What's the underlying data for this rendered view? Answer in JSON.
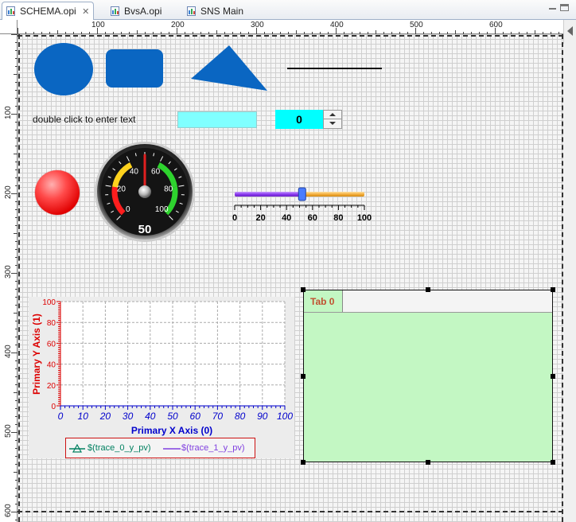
{
  "editor_tabs": [
    {
      "label": "SCHEMA.opi",
      "active": true,
      "closable": true
    },
    {
      "label": "BvsA.opi",
      "active": false,
      "closable": false
    },
    {
      "label": "SNS Main",
      "active": false,
      "closable": false
    }
  ],
  "ruler": {
    "horizontal_labels": [
      "100",
      "200",
      "300",
      "400",
      "500",
      "600"
    ],
    "vertical_labels": [
      "100",
      "200",
      "300",
      "400",
      "500",
      "600"
    ]
  },
  "widgets": {
    "label_text": "double click to enter text",
    "text_input_value": "",
    "spinner_value": "0",
    "gauge": {
      "value": 50,
      "min": 0,
      "max": 100,
      "ticks": [
        "0",
        "20",
        "40",
        "60",
        "80",
        "100"
      ],
      "readout": "50"
    },
    "slider": {
      "value": 52,
      "min": 0,
      "max": 100,
      "ticks": [
        "0",
        "20",
        "40",
        "60",
        "80",
        "100"
      ]
    },
    "tab_container": {
      "tabs": [
        "Tab 0"
      ]
    }
  },
  "colors": {
    "shape_blue": "#0a66c2",
    "input_cyan": "#80ffff",
    "spinner_cyan": "#00ffff",
    "led_red": "#ff2020",
    "tab_green": "#c3f7c3",
    "axis_red": "#dd0000",
    "axis_blue": "#0000cc",
    "trace0": "#008060",
    "trace1": "#8040e0"
  },
  "chart_data": {
    "type": "line",
    "title": "",
    "xlabel": "Primary X Axis (0)",
    "ylabel": "Primary Y Axis (1)",
    "xlim": [
      0,
      100
    ],
    "ylim": [
      0,
      100
    ],
    "x_ticks": [
      "0",
      "10",
      "20",
      "30",
      "40",
      "50",
      "60",
      "70",
      "80",
      "90",
      "100"
    ],
    "y_ticks": [
      "0",
      "20",
      "40",
      "60",
      "80",
      "100"
    ],
    "grid": true,
    "legend_position": "bottom",
    "series": [
      {
        "name": "$(trace_0_y_pv)",
        "values": []
      },
      {
        "name": "$(trace_1_y_pv)",
        "values": []
      }
    ]
  }
}
